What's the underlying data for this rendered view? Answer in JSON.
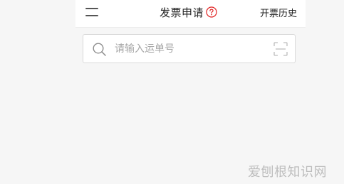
{
  "header": {
    "title": "发票申请",
    "history_label": "开票历史",
    "help_icon_color": "#e02020"
  },
  "search": {
    "placeholder": "请输入运单号",
    "value": ""
  },
  "watermark": {
    "text": "爱刨根知识网"
  }
}
